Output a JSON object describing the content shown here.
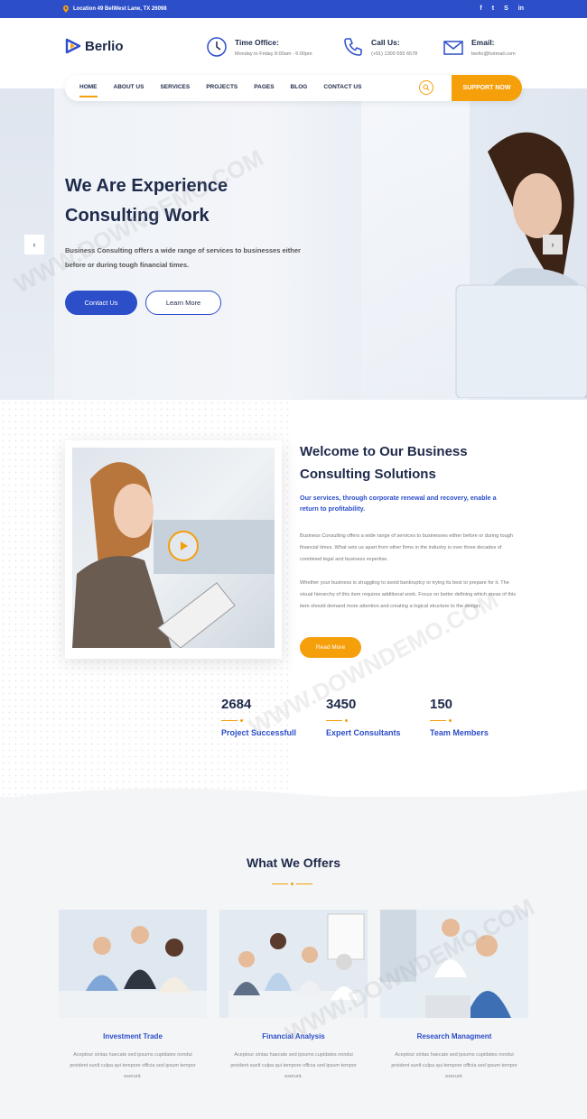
{
  "topbar": {
    "location": "Location 49 BelWest Lane, TX 26098",
    "social": [
      {
        "icon": "facebook-icon",
        "glyph": "f"
      },
      {
        "icon": "twitter-icon",
        "glyph": "t"
      },
      {
        "icon": "skype-icon",
        "glyph": "S"
      },
      {
        "icon": "linkedin-icon",
        "glyph": "in"
      }
    ]
  },
  "header": {
    "logo": "Berlio",
    "time_label": "Time Office:",
    "time_value": "Monday to Friday 8:00am - 6:00pm",
    "call_label": "Call Us:",
    "call_value": "(+91) 1300 555 6578",
    "email_label": "Email:",
    "email_value": "berlio@hotmail.com"
  },
  "nav": {
    "items": [
      "HOME",
      "ABOUT US",
      "SERVICES",
      "PROJECTS",
      "PAGES",
      "BLOG",
      "CONTACT US"
    ],
    "support": "SUPPORT NOW"
  },
  "hero": {
    "title_line1": "We Are Experience",
    "title_line2": "Consulting Work",
    "subtitle": "Business Consulting offers a wide range of services to businesses either before or during tough financial times.",
    "primary_button": "Contact Us",
    "secondary_button": "Learn More",
    "prev": "‹",
    "next": "›"
  },
  "about": {
    "title": "Welcome to Our Business Consulting Solutions",
    "lead": "Our services, through corporate renewal and recovery, enable a return to profitability.",
    "para1": "Business Consulting offers a wide range of services to businesses either before or during tough financial times. What sets us apart from other firms in the industry is over three decades of combined legal and business expertise.",
    "para2": "Whether your business is struggling to avoid bankruptcy or trying its best to prepare for it. The visual hierarchy of this item requires additional work. Focus on better defining which areas of this item should demand more attention and creating a logical structure to the design.",
    "read_more": "Read More",
    "stats": [
      {
        "num": "2684",
        "label": "Project Successfull"
      },
      {
        "num": "3450",
        "label": "Expert Consultants"
      },
      {
        "num": "150",
        "label": "Team Members"
      }
    ]
  },
  "offers": {
    "title": "What We Offers",
    "cards": [
      {
        "title": "Investment Trade",
        "desc": "Aceptour sintas haecate sed ipsums cupidates nondui proident sunlt culpa qui tempore officia sed ipsum tempor exerunt."
      },
      {
        "title": "Financial Analysis",
        "desc": "Aceptour sintas haecate sed ipsums cupidates nondui proident sunlt culpa qui tempore officia sed ipsum tempor exerunt."
      },
      {
        "title": "Research Managment",
        "desc": "Aceptour sintas haecate sed ipsums cupidates nondui proident sunlt culpa qui tempore officia sed ipsum tempor exerunt."
      }
    ]
  },
  "watermark": "WWW.DOWNDEMO.COM",
  "colors": {
    "brand": "#2c4ec9",
    "accent": "#f59f0b",
    "dark": "#1e2a4a"
  }
}
